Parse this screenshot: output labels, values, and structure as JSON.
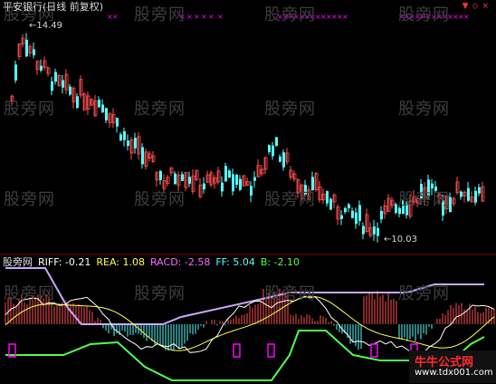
{
  "chart": {
    "title": "平安银行(日线 前复权)",
    "high_label": "14.49",
    "low_label": "10.03",
    "watermark": "股旁网",
    "corner_icons": [
      "down-arrow-icon",
      "diamond-icon",
      "close-icon"
    ],
    "indicator": {
      "name": "股旁网",
      "riff": "RIFF: -0.21",
      "rea": "REA: 1.08",
      "racd": "RACD: -2.58",
      "ff": "FF: 5.04",
      "b": "B: -2.10"
    },
    "logo": {
      "text": "牛牛公式网",
      "url": "www.tdx001.com"
    },
    "colors": {
      "up": "#ff4f4f",
      "down": "#54ffff",
      "riff": "#ffffff",
      "rea": "#ffff4f",
      "racd": "#ff66ff",
      "ff": "#54ffff",
      "b": "#4fff4f",
      "purple": "#c8a8ff",
      "magenta": "#ff00ff"
    }
  },
  "chart_data": {
    "type": "candlestick",
    "high": 14.49,
    "low": 10.03,
    "series_indicators": [
      "RIFF",
      "REA",
      "RACD",
      "FF",
      "B"
    ],
    "indicator_values": {
      "RIFF": -0.21,
      "REA": 1.08,
      "RACD": -2.58,
      "FF": 5.04,
      "B": -2.1
    }
  }
}
